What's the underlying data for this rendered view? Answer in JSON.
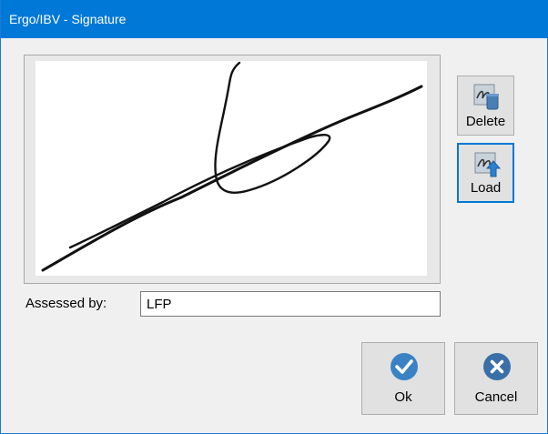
{
  "window": {
    "title": "Ergo/IBV - Signature"
  },
  "side_buttons": {
    "delete_label": "Delete",
    "load_label": "Load"
  },
  "assessed": {
    "label": "Assessed by:",
    "value": "LFP"
  },
  "footer_buttons": {
    "ok_label": "Ok",
    "cancel_label": "Cancel"
  },
  "colors": {
    "titlebar": "#0078d7",
    "accent": "#0078d7",
    "ok_icon": "#3b82c4",
    "cancel_icon": "#3a6fa8"
  }
}
